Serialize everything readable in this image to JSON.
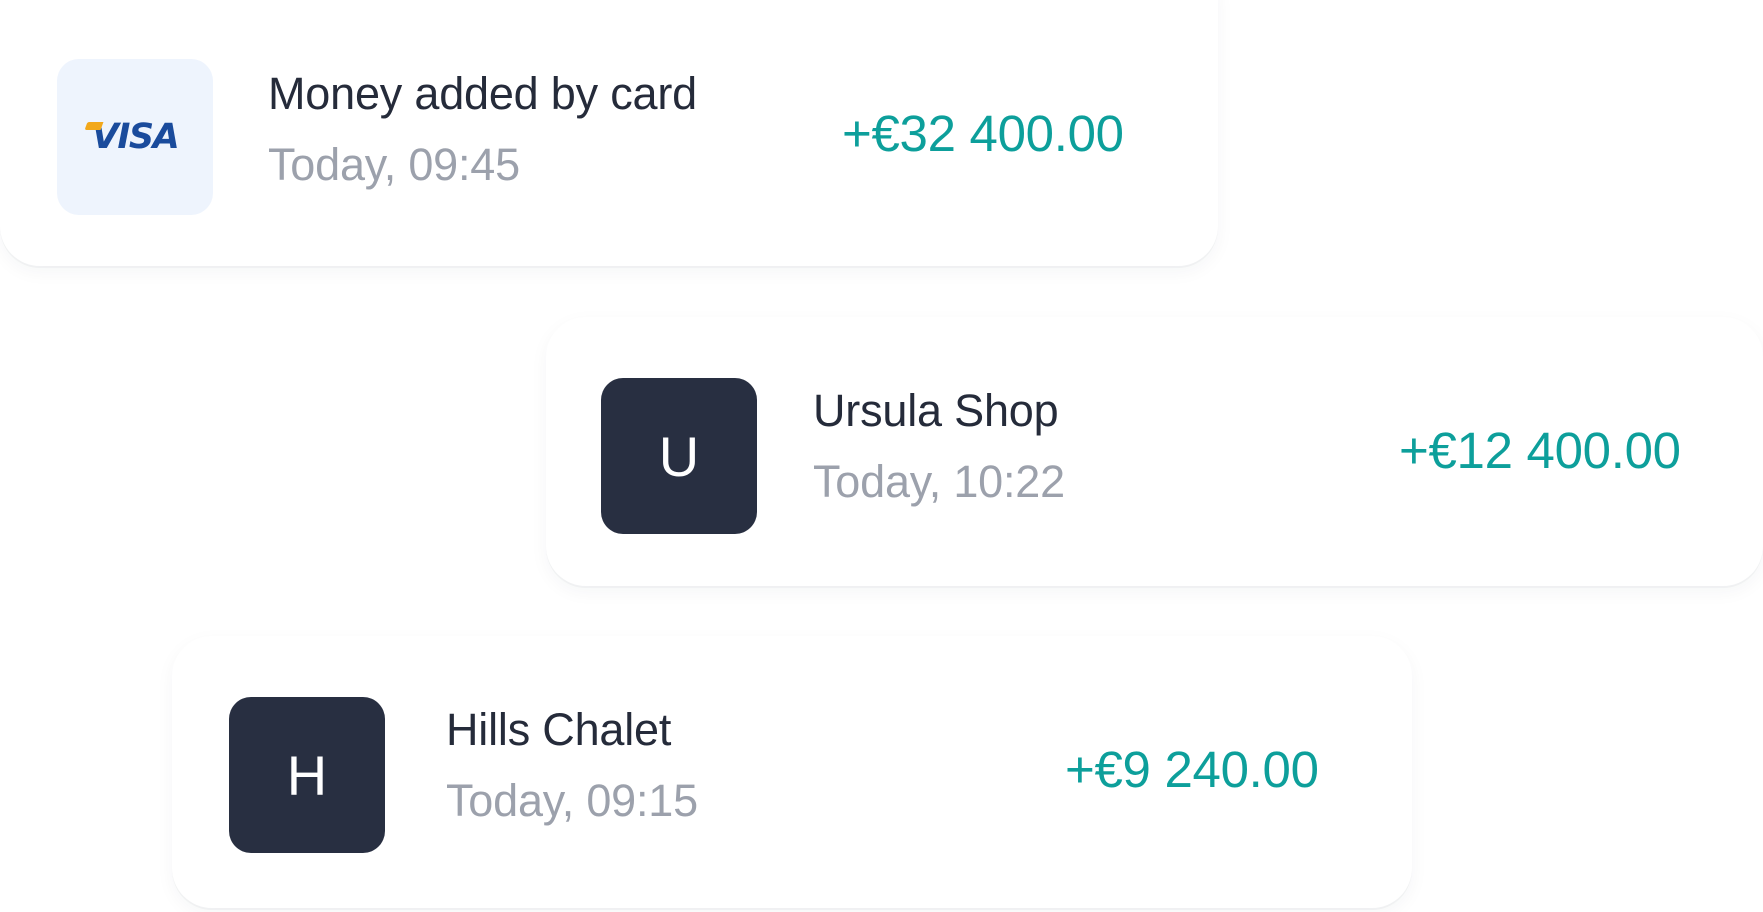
{
  "transactions": [
    {
      "title": "Money added by card",
      "time": "Today, 09:45",
      "amount": "+€32 400.00",
      "avatar": {
        "type": "logo",
        "text": "VISA",
        "icon": "visa-logo"
      }
    },
    {
      "title": "Ursula Shop",
      "time": "Today, 10:22",
      "amount": "+€12 400.00",
      "avatar": {
        "type": "letter",
        "text": "U"
      }
    },
    {
      "title": "Hills Chalet",
      "time": "Today, 09:15",
      "amount": "+€9 240.00",
      "avatar": {
        "type": "letter",
        "text": "H"
      }
    }
  ],
  "colors": {
    "amount_positive": "#0d9f9b",
    "title": "#252b3a",
    "time": "#9ca1ac",
    "letter_avatar_bg": "#282f41",
    "visa_avatar_bg": "#eef4fd",
    "visa_blue": "#1a4b9c",
    "visa_gold": "#f2a81b"
  }
}
